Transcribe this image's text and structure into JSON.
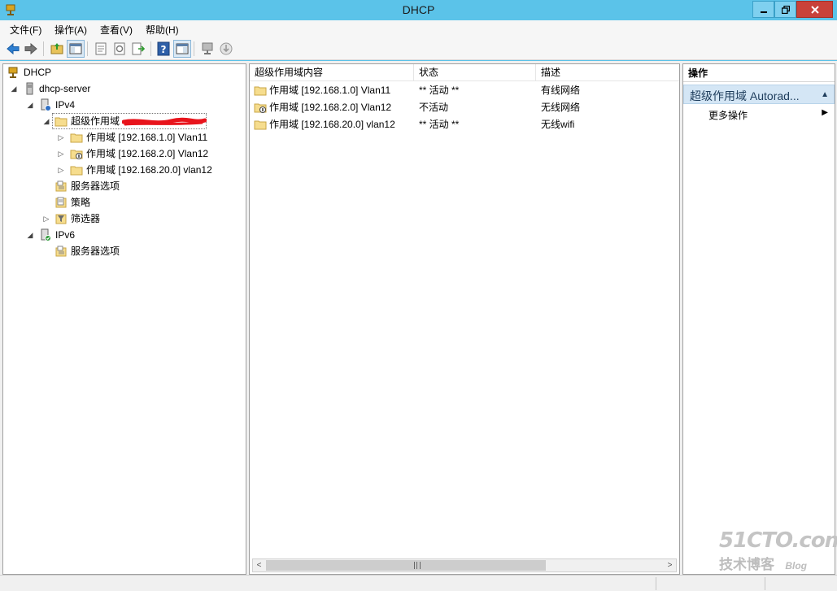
{
  "window": {
    "title": "DHCP"
  },
  "menubar": [
    {
      "label": "文件(F)"
    },
    {
      "label": "操作(A)"
    },
    {
      "label": "查看(V)"
    },
    {
      "label": "帮助(H)"
    }
  ],
  "tree": {
    "root": "DHCP",
    "server": "dhcp-server",
    "ipv4": "IPv4",
    "superscope": "超级作用域",
    "scopes": [
      {
        "label": "作用域 [192.168.1.0] Vlan11"
      },
      {
        "label": "作用域 [192.168.2.0] Vlan12"
      },
      {
        "label": "作用域 [192.168.20.0] vlan12"
      }
    ],
    "server_options_v4": "服务器选项",
    "policies": "策略",
    "filters": "筛选器",
    "ipv6": "IPv6",
    "server_options_v6": "服务器选项"
  },
  "list": {
    "columns": [
      "超级作用域内容",
      "状态",
      "描述"
    ],
    "rows": [
      {
        "name": "作用域 [192.168.1.0] Vlan11",
        "status": "** 活动 **",
        "desc": "有线网络"
      },
      {
        "name": "作用域 [192.168.2.0] Vlan12",
        "status": "不活动",
        "desc": "无线网络"
      },
      {
        "name": "作用域 [192.168.20.0] vlan12",
        "status": "** 活动 **",
        "desc": "无线wifi"
      }
    ]
  },
  "actions": {
    "title": "操作",
    "group": "超级作用域 Autorad...",
    "more": "更多操作"
  },
  "watermark": {
    "logo": "51CTO.com",
    "sub": "技术博客",
    "blog": "Blog"
  },
  "colors": {
    "titlebar": "#5bc3e9",
    "close_button": "#c9423a",
    "action_group": "#d4e6f5"
  }
}
